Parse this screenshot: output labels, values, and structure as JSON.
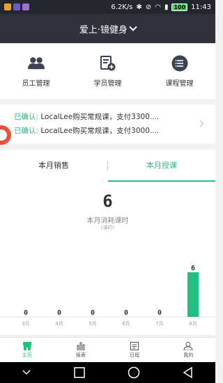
{
  "status_bar": {
    "speed": "6.2K/s",
    "battery": "100",
    "time": "11:43"
  },
  "header": {
    "title": "爱上·镜健身"
  },
  "quick_nav": [
    {
      "label": "员工管理",
      "icon": "staff-icon"
    },
    {
      "label": "学员管理",
      "icon": "student-icon"
    },
    {
      "label": "课程管理",
      "icon": "course-icon"
    }
  ],
  "notices": [
    {
      "status": "已确认:",
      "text": " LocalLee购买常规课，支付3300...."
    },
    {
      "status": "已确认:",
      "text": " LocalLee购买常规课，支付3000...."
    }
  ],
  "tabs": [
    {
      "label": "本月销售",
      "active": false
    },
    {
      "label": "本月授课",
      "active": true
    }
  ],
  "summary": {
    "value": "6",
    "label": "本月消耗课时",
    "unit": "(课时)"
  },
  "chart_data": {
    "type": "bar",
    "categories": [
      "3月",
      "4月",
      "5月",
      "6月",
      "7月",
      "8月"
    ],
    "values": [
      0,
      0,
      0,
      0,
      0,
      6
    ],
    "title": "",
    "xlabel": "",
    "ylabel": "",
    "bar_color": "#22c07e"
  },
  "bottom_nav": [
    {
      "label": "主页",
      "icon": "home-icon",
      "active": true
    },
    {
      "label": "报表",
      "icon": "report-icon",
      "active": false
    },
    {
      "label": "日程",
      "icon": "schedule-icon",
      "active": false
    },
    {
      "label": "我的",
      "icon": "profile-icon",
      "active": false
    }
  ],
  "colors": {
    "accent": "#22c07e",
    "header": "#2f323a"
  }
}
